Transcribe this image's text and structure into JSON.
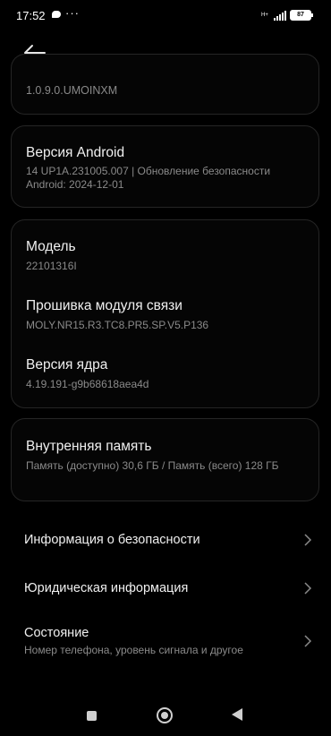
{
  "status_bar": {
    "time": "17:52",
    "network_type": "H+",
    "battery": "87"
  },
  "top_card": {
    "value": "1.0.9.0.UMOINXM"
  },
  "android_card": {
    "title": "Версия Android",
    "value": "14 UP1A.231005.007 | Обновление безопасности Android: 2024-12-01"
  },
  "device_card": {
    "items": [
      {
        "title": "Модель",
        "value": "22101316I"
      },
      {
        "title": "Прошивка модуля связи",
        "value": "MOLY.NR15.R3.TC8.PR5.SP.V5.P136"
      },
      {
        "title": "Версия ядра",
        "value": "4.19.191-g9b68618aea4d"
      }
    ]
  },
  "storage_card": {
    "title": "Внутренняя память",
    "value": "Память (доступно)  30,6 ГБ / Память (всего)  128 ГБ"
  },
  "menu": [
    {
      "title": "Информация о безопасности",
      "subtitle": ""
    },
    {
      "title": "Юридическая информация",
      "subtitle": ""
    },
    {
      "title": "Состояние",
      "subtitle": "Номер телефона, уровень сигнала и другое"
    }
  ],
  "icons": {
    "back": "arrow-left-icon",
    "chevron": "chevron-right-icon",
    "nav_recent": "square-icon",
    "nav_home": "circle-icon",
    "nav_back": "triangle-icon"
  }
}
